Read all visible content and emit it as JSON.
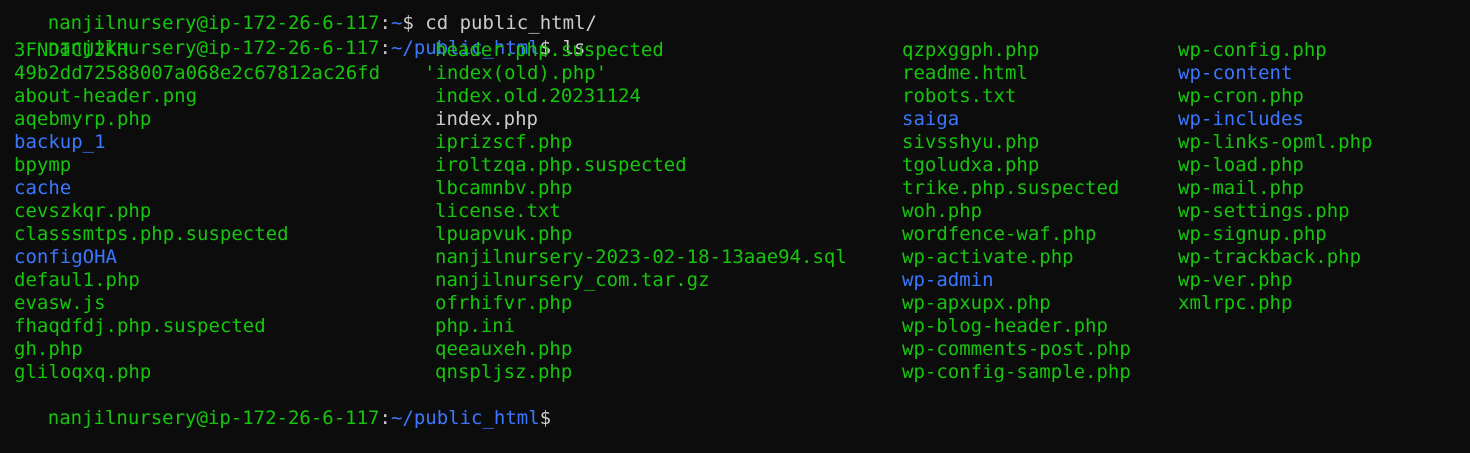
{
  "prompt": {
    "userhost": "nanjilnursery@ip-172-26-6-117",
    "sep": ":",
    "path": "~/public_html",
    "symbol": "$"
  },
  "first_line": {
    "userhost": "nanjilnursery@ip-172-26-6-117",
    "sep": ":",
    "path": "~",
    "symbol": "$",
    "command": " cd public_html/"
  },
  "second_line": {
    "command": " ls"
  },
  "columns": [
    [
      {
        "name": "3FNDICU2KH",
        "type": "file"
      },
      {
        "name": "49b2dd72588007a068e2c67812ac26fd",
        "type": "file"
      },
      {
        "name": "about-header.png",
        "type": "file"
      },
      {
        "name": "aqebmyrp.php",
        "type": "file"
      },
      {
        "name": "backup_1",
        "type": "dir"
      },
      {
        "name": "bpymp",
        "type": "file"
      },
      {
        "name": "cache",
        "type": "dir"
      },
      {
        "name": "cevszkqr.php",
        "type": "file"
      },
      {
        "name": "classsmtps.php.suspected",
        "type": "file"
      },
      {
        "name": "configOHA",
        "type": "dir"
      },
      {
        "name": "defaul1.php",
        "type": "file"
      },
      {
        "name": "evasw.js",
        "type": "file"
      },
      {
        "name": "fhaqdfdj.php.suspected",
        "type": "file"
      },
      {
        "name": "gh.php",
        "type": "file"
      },
      {
        "name": "gliloqxq.php",
        "type": "file"
      }
    ],
    [
      {
        "name": "header.php.suspected",
        "type": "file"
      },
      {
        "name": "'index(old).php'",
        "type": "file",
        "quoted": true
      },
      {
        "name": "index.old.20231124",
        "type": "file"
      },
      {
        "name": "index.php",
        "type": "plain"
      },
      {
        "name": "iprizscf.php",
        "type": "file"
      },
      {
        "name": "iroltzqa.php.suspected",
        "type": "file"
      },
      {
        "name": "lbcamnbv.php",
        "type": "file"
      },
      {
        "name": "license.txt",
        "type": "file"
      },
      {
        "name": "lpuapvuk.php",
        "type": "file"
      },
      {
        "name": "nanjilnursery-2023-02-18-13aae94.sql",
        "type": "file"
      },
      {
        "name": "nanjilnursery_com.tar.gz",
        "type": "file"
      },
      {
        "name": "ofrhifvr.php",
        "type": "file"
      },
      {
        "name": "php.ini",
        "type": "file"
      },
      {
        "name": "qeeauxeh.php",
        "type": "file"
      },
      {
        "name": "qnspljsz.php",
        "type": "file"
      }
    ],
    [
      {
        "name": "qzpxggph.php",
        "type": "file"
      },
      {
        "name": "readme.html",
        "type": "file"
      },
      {
        "name": "robots.txt",
        "type": "file"
      },
      {
        "name": "saiga",
        "type": "dir"
      },
      {
        "name": "sivsshyu.php",
        "type": "file"
      },
      {
        "name": "tgoludxa.php",
        "type": "file"
      },
      {
        "name": "trike.php.suspected",
        "type": "file"
      },
      {
        "name": "woh.php",
        "type": "file"
      },
      {
        "name": "wordfence-waf.php",
        "type": "file"
      },
      {
        "name": "wp-activate.php",
        "type": "file"
      },
      {
        "name": "wp-admin",
        "type": "dir"
      },
      {
        "name": "wp-apxupx.php",
        "type": "file"
      },
      {
        "name": "wp-blog-header.php",
        "type": "file"
      },
      {
        "name": "wp-comments-post.php",
        "type": "file"
      },
      {
        "name": "wp-config-sample.php",
        "type": "file"
      }
    ],
    [
      {
        "name": "wp-config.php",
        "type": "file"
      },
      {
        "name": "wp-content",
        "type": "dir"
      },
      {
        "name": "wp-cron.php",
        "type": "file"
      },
      {
        "name": "wp-includes",
        "type": "dir"
      },
      {
        "name": "wp-links-opml.php",
        "type": "file"
      },
      {
        "name": "wp-load.php",
        "type": "file"
      },
      {
        "name": "wp-mail.php",
        "type": "file"
      },
      {
        "name": "wp-settings.php",
        "type": "file"
      },
      {
        "name": "wp-signup.php",
        "type": "file"
      },
      {
        "name": "wp-trackback.php",
        "type": "file"
      },
      {
        "name": "wp-ver.php",
        "type": "file"
      },
      {
        "name": "xmlrpc.php",
        "type": "file"
      }
    ]
  ],
  "colors": {
    "background": "#0c0c0c",
    "executable_green": "#16c60c",
    "directory_blue": "#3b78ff",
    "plain_text": "#cccccc"
  }
}
